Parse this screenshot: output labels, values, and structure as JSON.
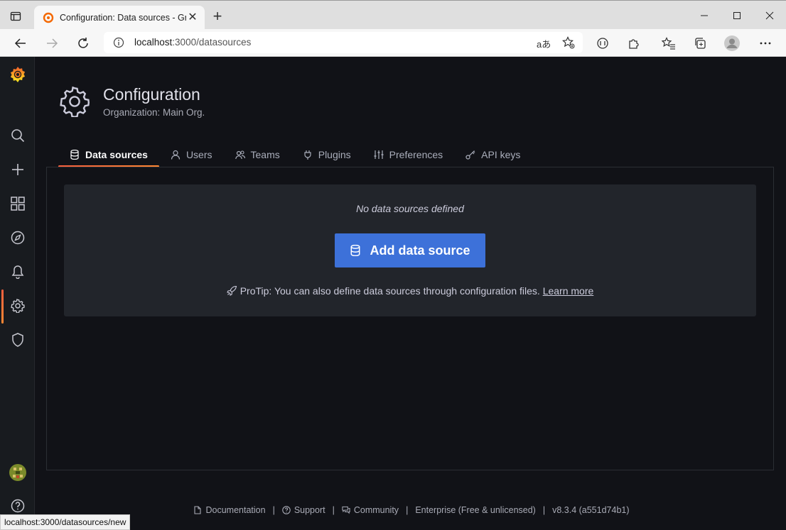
{
  "browser": {
    "tab_title": "Configuration: Data sources - Gr",
    "new_tab": "+",
    "address_host": "localhost",
    "address_path": ":3000/datasources",
    "read_aloud": "aあ",
    "status_url": "localhost:3000/datasources/new"
  },
  "sidebar": {
    "items": [
      "grafana-logo",
      "search-icon",
      "plus-icon",
      "dashboards-icon",
      "explore-icon",
      "alerting-icon",
      "gear-icon",
      "shield-icon",
      "avatar",
      "help-icon"
    ],
    "active": "gear-icon"
  },
  "page": {
    "title": "Configuration",
    "subtitle": "Organization: Main Org."
  },
  "tabs": [
    {
      "label": "Data sources",
      "icon": "database-icon",
      "active": true
    },
    {
      "label": "Users",
      "icon": "user-icon",
      "active": false
    },
    {
      "label": "Teams",
      "icon": "users-icon",
      "active": false
    },
    {
      "label": "Plugins",
      "icon": "plug-icon",
      "active": false
    },
    {
      "label": "Preferences",
      "icon": "sliders-icon",
      "active": false
    },
    {
      "label": "API keys",
      "icon": "key-icon",
      "active": false
    }
  ],
  "empty": {
    "title": "No data sources defined",
    "button_label": "Add data source",
    "protip": "ProTip: You can also define data sources through configuration files.",
    "learn_more": "Learn more"
  },
  "footer": {
    "documentation": "Documentation",
    "support": "Support",
    "community": "Community",
    "edition": "Enterprise (Free & unlicensed)",
    "version": "v8.3.4 (a551d74b1)",
    "separator": "|"
  },
  "colors": {
    "accent": "#f55f3e",
    "primary_button": "#3d71d9",
    "background": "#111217"
  }
}
